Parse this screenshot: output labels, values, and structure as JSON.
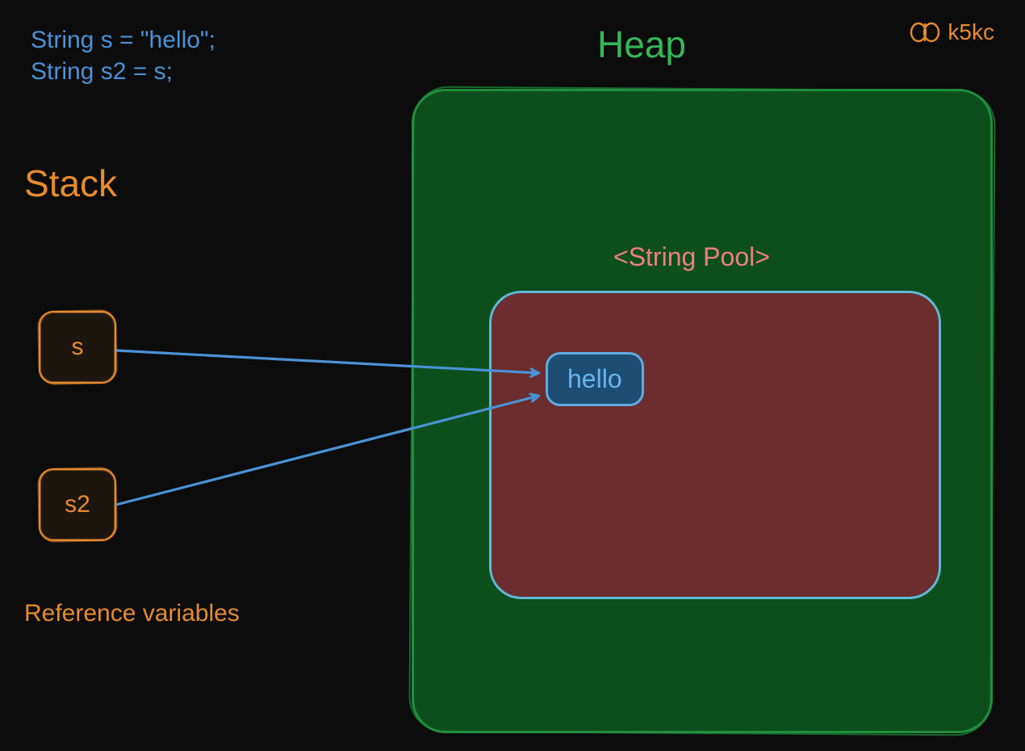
{
  "code": {
    "line1": "String s = \"hello\";",
    "line2": "String s2 = s;"
  },
  "labels": {
    "stack": "Stack",
    "heap": "Heap",
    "string_pool": "<String Pool>",
    "reference_variables": "Reference variables"
  },
  "stack_vars": {
    "s": "s",
    "s2": "s2"
  },
  "heap": {
    "hello_value": "hello"
  },
  "logo": {
    "text": "k5kc"
  },
  "colors": {
    "background": "#0c0c0c",
    "code_blue": "#4a92d7",
    "orange": "#e78b2e",
    "green_stroke": "#1f8f3d",
    "green_fill": "#0d4f1c",
    "heap_title": "#34b759",
    "pool_border": "#5fb9da",
    "pool_fill": "#6b2d2d",
    "pool_label": "#ee7f7f",
    "hello_border": "#62a9e0",
    "hello_fill": "#1e4d73",
    "arrow": "#4a92d7"
  }
}
